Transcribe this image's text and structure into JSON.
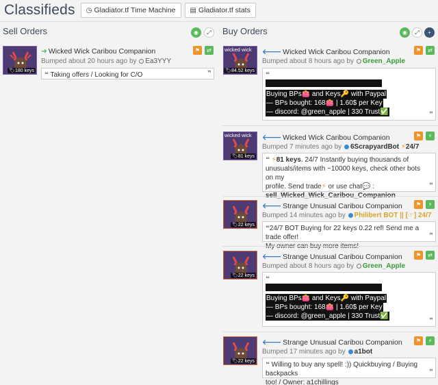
{
  "header": {
    "title": "Classifieds",
    "btn_timemachine": "Gladiator.tf Time Machine",
    "btn_stats": "Gladiator.tf stats"
  },
  "sell": {
    "title": "Sell Orders",
    "listing": {
      "item": "Wicked Wick Caribou Companion",
      "bumped": "Bumped about 20 hours ago by",
      "user": "Ea3YYY",
      "keys": "180 keys",
      "comment": "Taking offers / Looking for C/O"
    }
  },
  "buy": {
    "title": "Buy Orders",
    "listings": [
      {
        "item": "Wicked Wick Caribou Companion",
        "thumb_label": "wicked wick",
        "keys": "84.52 keys",
        "bumped": "Bumped about 8 hours ago by",
        "user": "Green_Apple",
        "lines": [
          "Buying BPs👛 and Keys🔑 with Paypal",
          "— BPs bought: 168👛 | 1.60$ per Key",
          "— discord: @green_apple | 330 Trust✅"
        ]
      },
      {
        "item": "Wicked Wick Caribou Companion",
        "thumb_label": "wicked wick",
        "keys": "81 keys",
        "bumped": "Bumped 7 minutes ago by",
        "user": "6ScrapyardBot",
        "user_suffix": "24/7",
        "comment_keys": "81 keys",
        "comment_1": ". 24/7 Instantly buying thousands of",
        "comment_2": "unusuals/items with ~10000 keys, check other bots on my",
        "comment_3": "profile. Send  trade",
        "comment_3b": " or  use  chat",
        "comment_3c": " :",
        "comment_4": "sell_Wicked_Wick_Caribou_Companion"
      },
      {
        "item": "Strange Unusual Caribou Companion",
        "keys": "22 keys",
        "bumped": "Bumped 14 minutes ago by",
        "user": "Philibert BOT || [☞] 24/7",
        "comment_1": "24/7 BOT Buying for 22 keys 0.22 ref! Send me a trade offer!",
        "comment_2": "My owner can buy more items!"
      },
      {
        "item": "Strange Unusual Caribou Companion",
        "keys": "22 keys",
        "bumped": "Bumped about 8 hours ago by",
        "user": "Green_Apple",
        "lines": [
          "Buying BPs👛 and Keys🔑 with Paypal",
          "— BPs bought: 168👛 | 1.60$ per Key",
          "— discord: @green_apple | 330 Trust✅"
        ]
      },
      {
        "item": "Strange Unusual Caribou Companion",
        "keys": "22 keys",
        "bumped": "Bumped 17 minutes ago by",
        "user": "a1bot",
        "comment_1": "Willing to buy any spell! :)) Quickbuying / Buying backpacks",
        "comment_2": "too! / Owner: a1chillings"
      }
    ]
  },
  "colors": {
    "accent_green": "#5cb85c",
    "accent_orange": "#f0932b",
    "link_blue": "#3c7bb5",
    "bot_gold": "#d8a32a"
  },
  "icons": [
    "clock-icon",
    "stats-icon",
    "eye-icon",
    "expand-icon",
    "plus-icon",
    "flag-icon",
    "exchange-icon",
    "lightning-icon",
    "quote-icon"
  ]
}
